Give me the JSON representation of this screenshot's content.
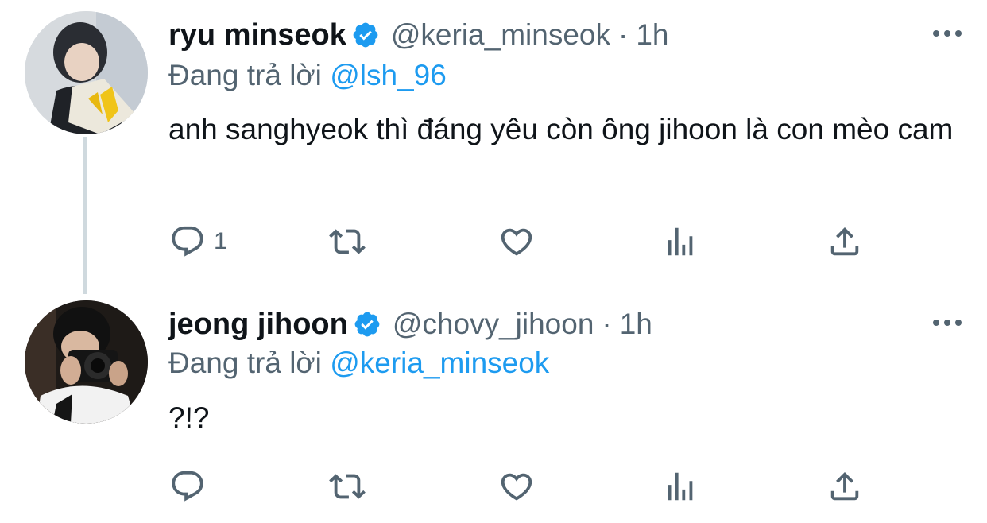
{
  "tweets": [
    {
      "display_name": "ryu minseok",
      "verified": true,
      "handle": "@keria_minseok",
      "separator": "·",
      "time": "1h",
      "reply_prefix": "Đang trả lời",
      "reply_to": "@lsh_96",
      "text": "anh sanghyeok thì đáng yêu còn ông jihoon là con mèo cam",
      "reply_count": "1",
      "avatar_icon": "avatar-photo"
    },
    {
      "display_name": "jeong jihoon",
      "verified": true,
      "handle": "@chovy_jihoon",
      "separator": "·",
      "time": "1h",
      "reply_prefix": "Đang trả lời",
      "reply_to": "@keria_minseok",
      "text": "?!?",
      "reply_count": "",
      "avatar_icon": "avatar-photo"
    }
  ],
  "icons": {
    "verified": "verified-badge-icon",
    "more": "more-options-icon",
    "reply": "reply-icon",
    "retweet": "retweet-icon",
    "like": "heart-icon",
    "views": "views-icon",
    "share": "share-icon"
  },
  "colors": {
    "text_primary": "#0f1419",
    "text_secondary": "#536471",
    "accent": "#1d9bf0",
    "thread_line": "#cfd9de"
  }
}
